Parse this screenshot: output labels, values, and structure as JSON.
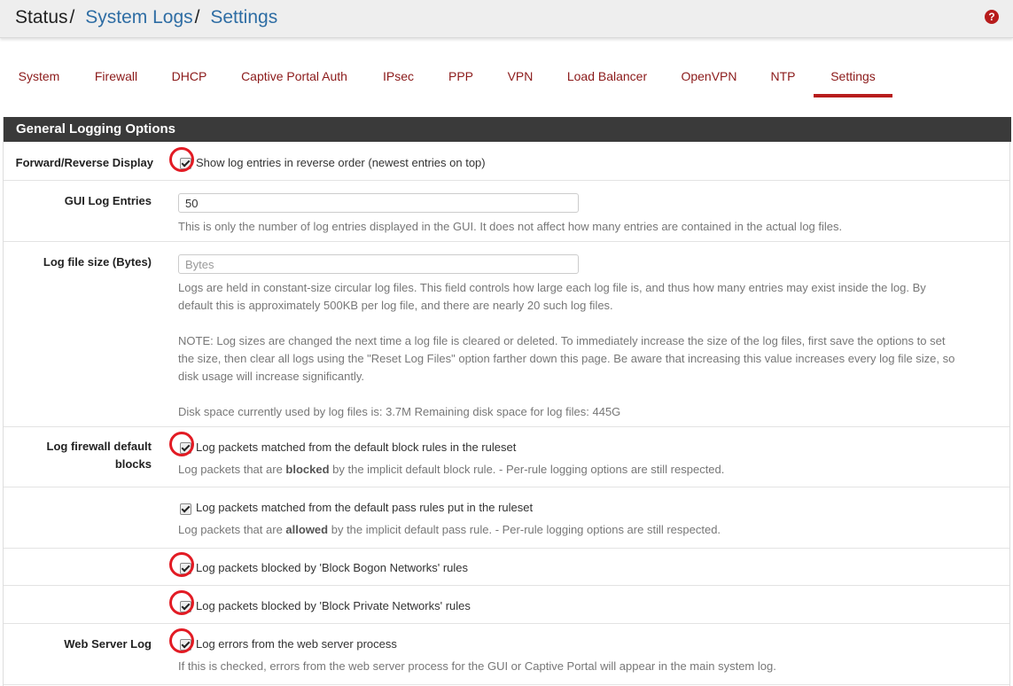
{
  "breadcrumb": {
    "status": "Status",
    "system_logs": "System Logs",
    "settings": "Settings",
    "separator": "/"
  },
  "help_icon": {
    "icon": "question-circle-icon",
    "glyph": "?"
  },
  "tabs": [
    {
      "label": "System"
    },
    {
      "label": "Firewall"
    },
    {
      "label": "DHCP"
    },
    {
      "label": "Captive Portal Auth"
    },
    {
      "label": "IPsec"
    },
    {
      "label": "PPP"
    },
    {
      "label": "VPN"
    },
    {
      "label": "Load Balancer"
    },
    {
      "label": "OpenVPN"
    },
    {
      "label": "NTP"
    },
    {
      "label": "Settings",
      "active": true
    }
  ],
  "panel": {
    "title": "General Logging Options",
    "forward_reverse": {
      "label": "Forward/Reverse Display",
      "checkbox_label": "Show log entries in reverse order (newest entries on top)",
      "checked": true
    },
    "gui_log_entries": {
      "label": "GUI Log Entries",
      "value": "50",
      "help": "This is only the number of log entries displayed in the GUI. It does not affect how many entries are contained in the actual log files."
    },
    "log_file_size": {
      "label": "Log file size (Bytes)",
      "placeholder": "Bytes",
      "help1_line1": "Logs are held in constant-size circular log files. This field controls how large each log file is, and thus how many entries may exist inside the log. By",
      "help1_line2": "default this is approximately 500KB per log file, and there are nearly 20 such log files.",
      "help2_line1": "NOTE: Log sizes are changed the next time a log file is cleared or deleted. To immediately increase the size of the log files, first save the options to set",
      "help2_line2": "the size, then clear all logs using the \"Reset Log Files\" option farther down this page. Be aware that increasing this value increases every log file size, so",
      "help2_line3": "disk usage will increase significantly.",
      "help3": "Disk space currently used by log files is: 3.7M Remaining disk space for log files: 445G"
    },
    "log_default_blocks": {
      "label_line1": "Log firewall default",
      "label_line2": "blocks",
      "checkbox_label": "Log packets matched from the default block rules in the ruleset",
      "help_pre": "Log packets that are ",
      "help_bold": "blocked",
      "help_post": " by the implicit default block rule. - Per-rule logging options are still respected.",
      "checked": true
    },
    "log_default_pass": {
      "checkbox_label": "Log packets matched from the default pass rules put in the ruleset",
      "help_pre": "Log packets that are ",
      "help_bold": "allowed",
      "help_post": " by the implicit default pass rule. - Per-rule logging options are still respected.",
      "checked": true
    },
    "log_bogon": {
      "checkbox_label": "Log packets blocked by 'Block Bogon Networks' rules",
      "checked": true
    },
    "log_private": {
      "checkbox_label": "Log packets blocked by 'Block Private Networks' rules",
      "checked": true
    },
    "web_server_log": {
      "label": "Web Server Log",
      "checkbox_label": "Log errors from the web server process",
      "help": "If this is checked, errors from the web server process for the GUI or Captive Portal will appear in the main system log.",
      "checked": true
    }
  },
  "colors": {
    "accent": "#b71c1c",
    "link": "#2e6da4",
    "heading_bg": "#3a3a3a",
    "annotation": "#e21b24"
  }
}
